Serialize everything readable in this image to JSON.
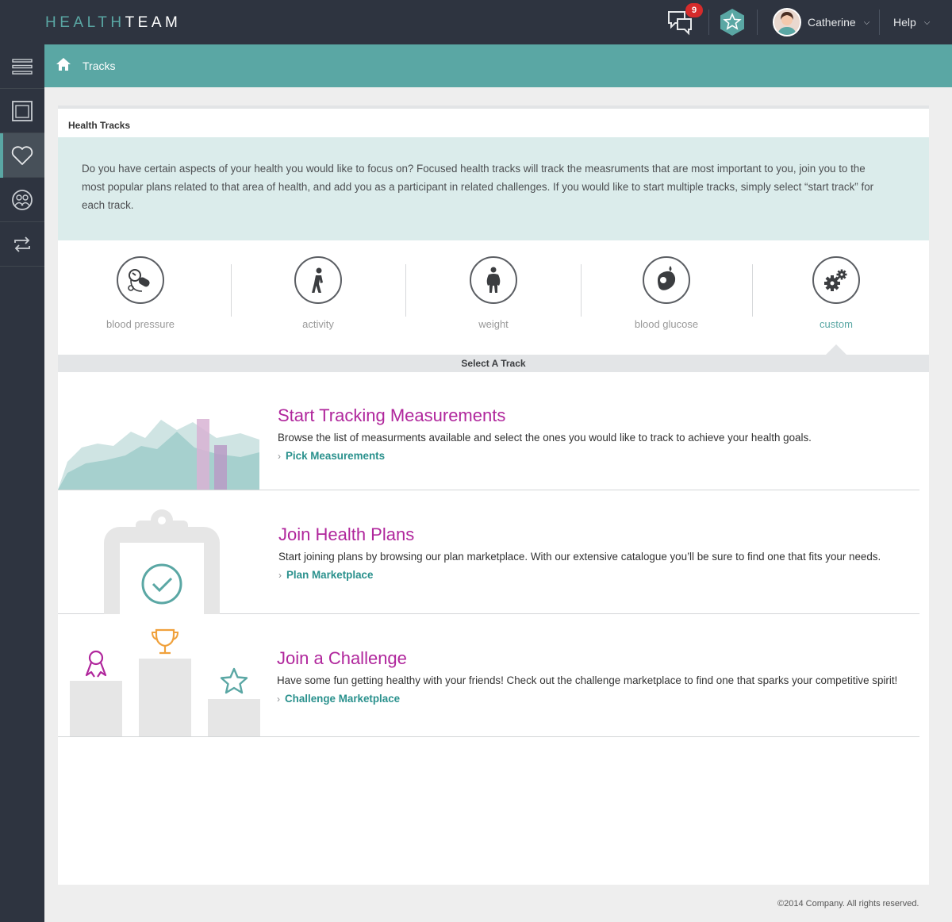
{
  "app": {
    "brand_light": "HEALTH",
    "brand_bold": "TEAM"
  },
  "header": {
    "notification_count": "9",
    "user_name": "Catherine",
    "help_label": "Help"
  },
  "breadcrumb": {
    "label": "Tracks"
  },
  "card": {
    "title": "Health Tracks",
    "intro": "Do you have certain aspects of your health you would like to focus on? Focused health tracks will track the measruments that are most important to you, join you to the most popular plans related to that area of health, and add you as a participant in related challenges. If you would like to start multiple tracks, simply select “start track” for each track."
  },
  "tracks": [
    {
      "label": "blood pressure",
      "icon": "blood-pressure-icon"
    },
    {
      "label": "activity",
      "icon": "walking-person-icon"
    },
    {
      "label": "weight",
      "icon": "body-weight-icon"
    },
    {
      "label": "blood glucose",
      "icon": "glucose-meter-icon"
    },
    {
      "label": "custom",
      "icon": "gears-icon",
      "selected": true
    }
  ],
  "select_track_label": "Select A Track",
  "sections": {
    "measurements": {
      "title": "Start Tracking Measurements",
      "desc": "Browse the list of measurments available and select the ones you would like to track to achieve your health goals.",
      "link": "Pick Measurements"
    },
    "plans": {
      "title": "Join Health Plans",
      "desc": "Start joining plans by browsing our plan marketplace. With our extensive catalogue you’ll be sure to find one that fits your needs.",
      "link": "Plan Marketplace"
    },
    "challenge": {
      "title": "Join a Challenge",
      "desc": "Have some fun getting healthy with your friends! Check out the challenge marketplace to find one that sparks your competitive spirit!",
      "link": "Challenge Marketplace"
    }
  },
  "footer": {
    "copyright": "©2014 Company. All rights reserved."
  },
  "colors": {
    "teal": "#5aa7a4",
    "magenta": "#b0269c",
    "dark": "#2e3440",
    "badge": "#d62b2b"
  }
}
